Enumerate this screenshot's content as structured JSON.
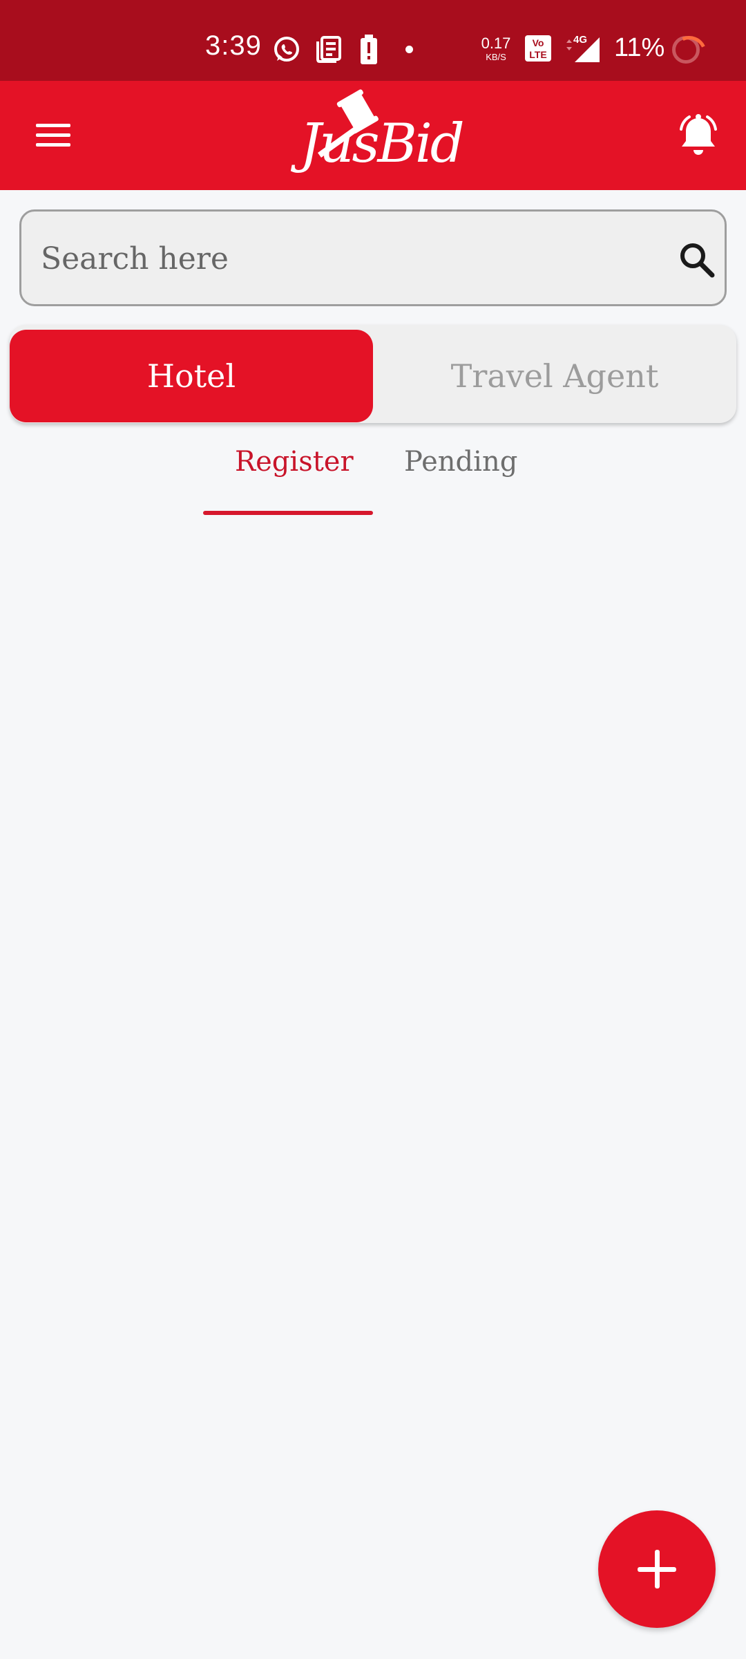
{
  "status_bar": {
    "time": "3:39",
    "net_speed_value": "0.17",
    "net_speed_unit": "KB/S",
    "network_type": "4G",
    "volte_label": "Vo LTE",
    "battery": "11%",
    "icons": [
      "whatsapp-icon",
      "news-icon",
      "battery-alert-icon",
      "dot-icon",
      "volte-icon",
      "signal-icon",
      "battery-ring-icon"
    ]
  },
  "app_bar": {
    "logo_text": "JusBid",
    "menu_icon": "hamburger-menu-icon",
    "notification_icon": "bell-icon"
  },
  "search": {
    "placeholder": "Search here",
    "value": ""
  },
  "segment": {
    "options": [
      "Hotel",
      "Travel Agent"
    ],
    "selected": "Hotel"
  },
  "tabs": {
    "items": [
      "Register",
      "Pending"
    ],
    "selected": "Register"
  },
  "fab": {
    "icon": "plus-icon"
  },
  "colors": {
    "primary": "#e41226",
    "status_bar": "#a80d1d",
    "background": "#f6f7f9",
    "tab_active": "#c8142a"
  }
}
